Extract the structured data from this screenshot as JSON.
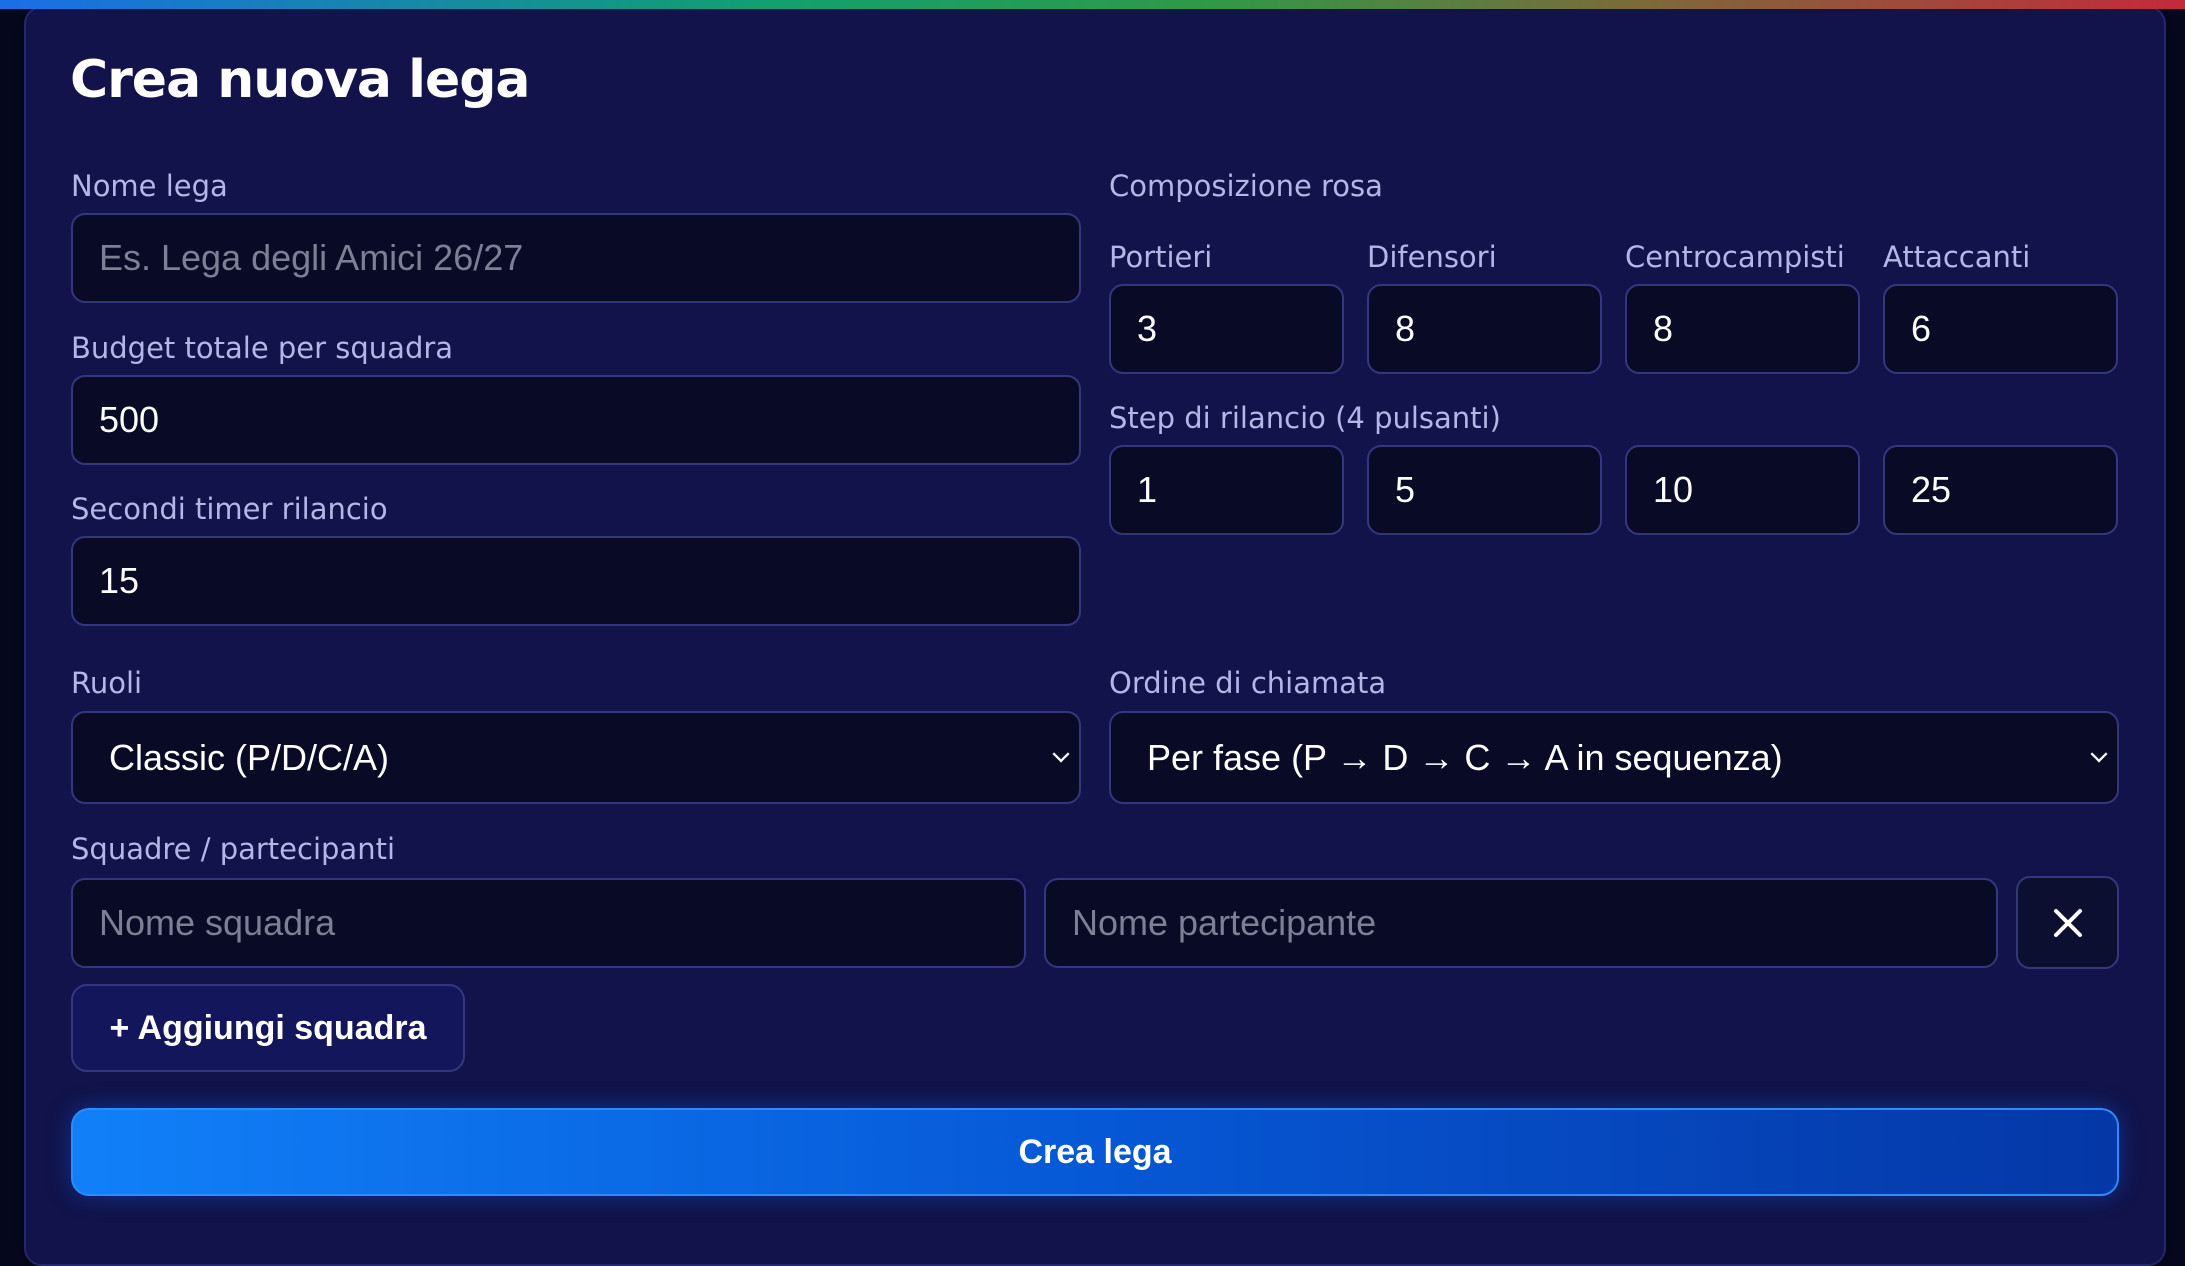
{
  "form": {
    "title": "Crea nuova lega",
    "league_name": {
      "label": "Nome lega",
      "value": "",
      "placeholder": "Es. Lega degli Amici 26/27"
    },
    "budget": {
      "label": "Budget totale per squadra",
      "value": "500"
    },
    "timer": {
      "label": "Secondi timer rilancio",
      "value": "15"
    },
    "roster": {
      "label": "Composizione rosa",
      "goalkeepers": {
        "label": "Portieri",
        "value": "3"
      },
      "defenders": {
        "label": "Difensori",
        "value": "8"
      },
      "midfielders": {
        "label": "Centrocampisti",
        "value": "8"
      },
      "forwards": {
        "label": "Attaccanti",
        "value": "6"
      }
    },
    "bid_steps": {
      "label": "Step di rilancio (4 pulsanti)",
      "values": [
        "1",
        "5",
        "10",
        "25"
      ]
    },
    "roles": {
      "label": "Ruoli",
      "selected": "Classic (P/D/C/A)"
    },
    "call_order": {
      "label": "Ordine di chiamata",
      "selected": "Per fase (P → D → C → A in sequenza)"
    },
    "teams": {
      "label": "Squadre / partecipanti",
      "team_name_placeholder": "Nome squadra",
      "participant_placeholder": "Nome partecipante",
      "remove_icon": "close-icon",
      "add_label": "+ Aggiungi squadra"
    },
    "submit_label": "Crea lega"
  },
  "colors": {
    "background": "#060820",
    "card": "#11134a",
    "input_bg": "#090a26",
    "border": "#34377e",
    "label": "#b3b6e6",
    "primary": "#0658d6"
  }
}
